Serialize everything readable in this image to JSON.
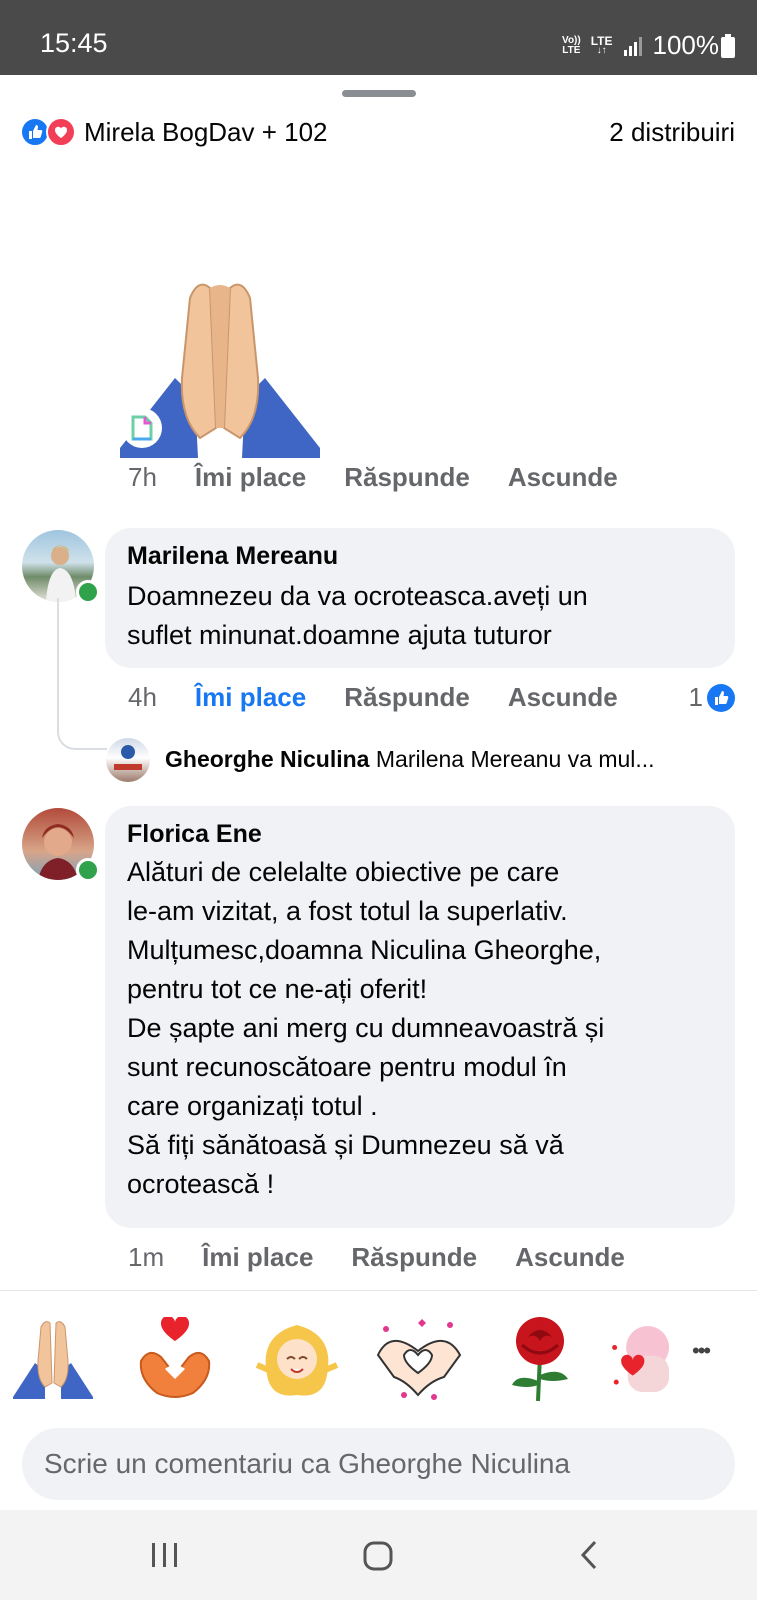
{
  "status_bar": {
    "time": "15:45",
    "volte_top": "Vo))",
    "volte_bottom": "LTE",
    "lte_label": "LTE",
    "battery_text": "100%"
  },
  "reactions": {
    "summary": "Mirela BogDav + 102",
    "shares": "2 distribuiri"
  },
  "first_comment": {
    "time": "7h",
    "like": "Îmi place",
    "reply": "Răspunde",
    "hide": "Ascunde"
  },
  "comments": [
    {
      "author": "Marilena Mereanu",
      "text": "Doamnezeu da va ocroteasca.aveți un\nsuflet minunat.doamne ajuta tuturor",
      "time": "4h",
      "like": "Îmi place",
      "reply": "Răspunde",
      "hide": "Ascunde",
      "like_count": "1",
      "liked": true
    },
    {
      "author": "Florica Ene",
      "text": "Alături de celelalte obiective pe care\nle-am vizitat, a fost totul la superlativ.\nMulțumesc,doamna Niculina Gheorghe,\npentru tot ce ne-ați oferit!\nDe șapte ani merg cu dumneavoastră și\nsunt recunoscătoare pentru modul în\ncare organizați totul .\nSă fiți sănătoasă și  Dumnezeu să vă\nocrotească !",
      "time": "1m",
      "like": "Îmi place",
      "reply": "Răspunde",
      "hide": "Ascunde"
    }
  ],
  "reply_preview": {
    "author": "Gheorghe Niculina",
    "text": "Marilena Mereanu  va mul..."
  },
  "sticker_tray": {
    "items": [
      "praying-hands",
      "heart-hands",
      "smiling-girl",
      "heart-hands-outline",
      "red-rose",
      "pink-character"
    ],
    "more": "•••"
  },
  "composer": {
    "placeholder": "Scrie un comentariu ca Gheorghe Niculina"
  },
  "colors": {
    "accent_blue": "#1877f2",
    "love_red": "#f33e58",
    "online_green": "#31a24c",
    "bubble_bg": "#f0f2f5",
    "meta_gray": "#65676b"
  }
}
